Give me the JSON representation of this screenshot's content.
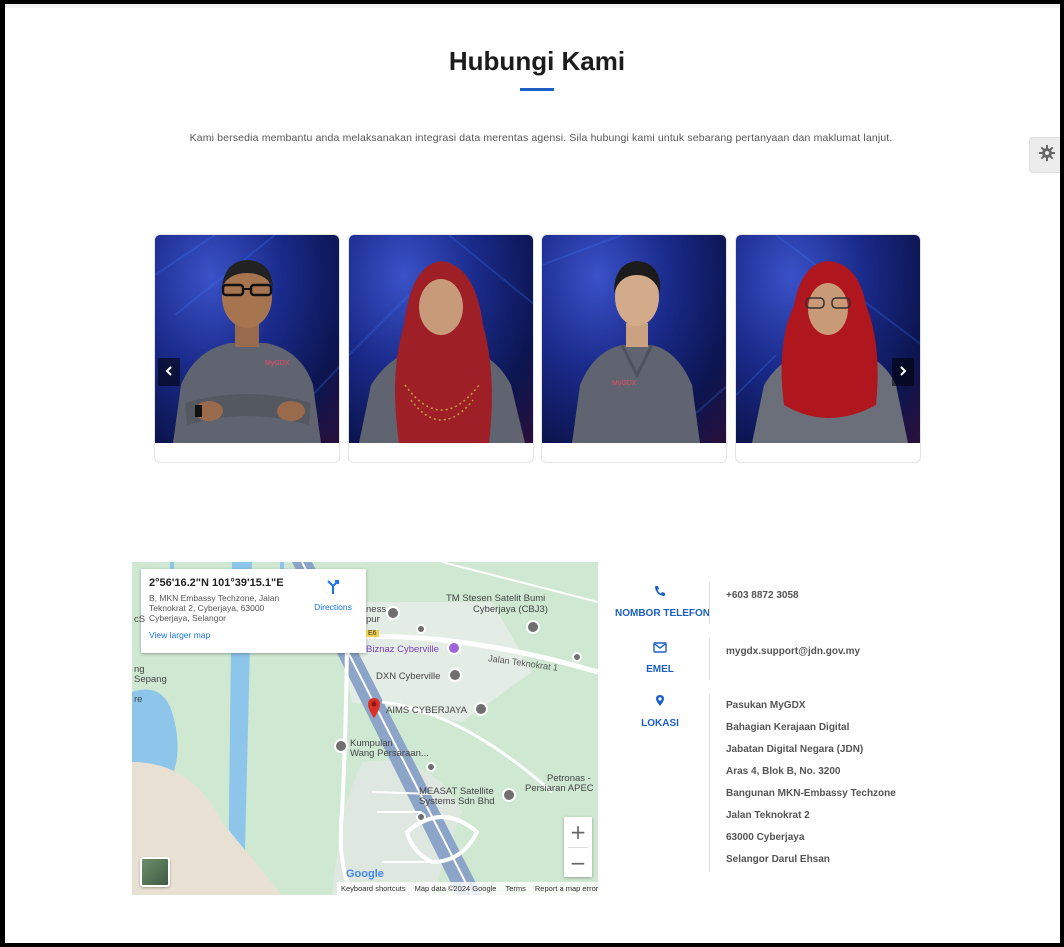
{
  "header": {
    "title": "Hubungi Kami",
    "subtitle": "Kami bersedia membantu anda melaksanakan integrasi data merentas agensi. Sila hubungi kami untuk sebarang pertanyaan dan maklumat lanjut."
  },
  "settings": {
    "icon": "gear-icon"
  },
  "carousel": {
    "prev_icon": "chevron-left-icon",
    "next_icon": "chevron-right-icon",
    "cards": [
      {
        "name": "",
        "hijab_color": ""
      },
      {
        "name": "",
        "hijab_color": "#9e1f26"
      },
      {
        "name": "",
        "hijab_color": ""
      },
      {
        "name": "",
        "hijab_color": "#b0161e"
      }
    ]
  },
  "map": {
    "coords": "2°56'16.2\"N 101°39'15.1\"E",
    "address": "B, MKN Embassy Techzone, Jalan Teknokrat 2, Cyberjaya, 63000 Cyberjaya, Selangor",
    "directions_label": "Directions",
    "larger_map_label": "View larger map",
    "labels": {
      "tm": "TM Stesen Satelit Bumi",
      "tm2": "Cyberjaya (CBJ3)",
      "ness": "ness",
      "pur": "pur",
      "biznaz": "Biznaz Cyberville",
      "jalan": "Jalan Teknokrat 1",
      "dxn": "DXN Cyberville",
      "aims": "AIMS CYBERJAYA",
      "kumpulan": "Kumpulan",
      "wang": "Wang Persaraan...",
      "measat": "MEASAT Satellite",
      "systems": "Systems Sdn Bhd",
      "petronas": "Petronas -",
      "persiaran": "Persiaran APEC",
      "ng": "ng",
      "sepang": "Sepang",
      "re": "re",
      "cs": "cS",
      "highway": "E6"
    },
    "google": "Google",
    "zoom_in": "+",
    "zoom_out": "−",
    "footer": {
      "shortcuts": "Keyboard shortcuts",
      "data": "Map data ©2024 Google",
      "terms": "Terms",
      "report": "Report a map error"
    }
  },
  "contact": {
    "phone": {
      "label": "NOMBOR TELEFON",
      "value": "+603 8872 3058",
      "icon": "phone-icon"
    },
    "email": {
      "label": "EMEL",
      "value": "mygdx.support@jdn.gov.my",
      "icon": "envelope-icon"
    },
    "location": {
      "label": "LOKASI",
      "icon": "map-pin-icon",
      "lines": [
        "Pasukan MyGDX",
        "Bahagian Kerajaan Digital",
        "Jabatan Digital Negara (JDN)",
        "Aras 4, Blok B, No. 3200",
        "Bangunan MKN-Embassy Techzone",
        "Jalan Teknokrat 2",
        "63000 Cyberjaya",
        "Selangor Darul Ehsan"
      ]
    }
  },
  "colors": {
    "accent": "#1c5fc7",
    "map_pin": "#d93025"
  }
}
